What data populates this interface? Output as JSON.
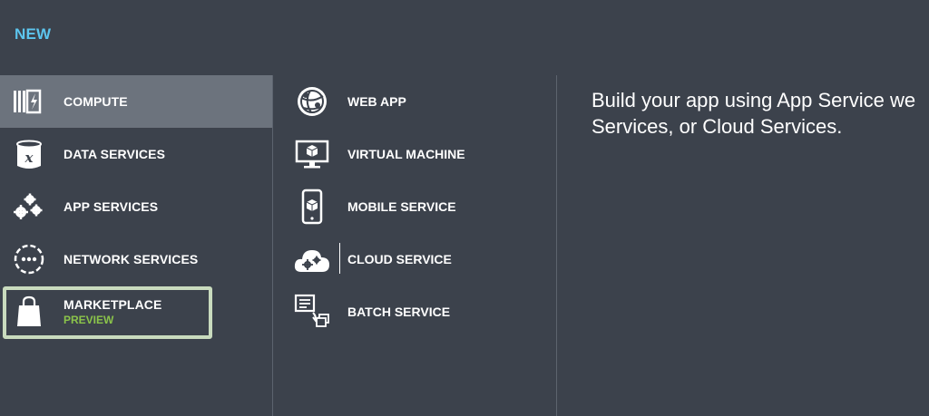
{
  "header": {
    "title": "NEW"
  },
  "categories": [
    {
      "label": "COMPUTE",
      "icon": "compute-icon",
      "selected": true
    },
    {
      "label": "DATA SERVICES",
      "icon": "data-services-icon"
    },
    {
      "label": "APP SERVICES",
      "icon": "app-services-icon"
    },
    {
      "label": "NETWORK SERVICES",
      "icon": "network-services-icon"
    },
    {
      "label": "MARKETPLACE",
      "sublabel": "PREVIEW",
      "icon": "marketplace-bag-icon"
    }
  ],
  "compute_items": [
    {
      "label": "WEB APP",
      "icon": "web-app-icon"
    },
    {
      "label": "VIRTUAL MACHINE",
      "icon": "virtual-machine-icon"
    },
    {
      "label": "MOBILE SERVICE",
      "icon": "mobile-service-icon"
    },
    {
      "label": "CLOUD SERVICE",
      "icon": "cloud-service-icon"
    },
    {
      "label": "BATCH SERVICE",
      "icon": "batch-service-icon"
    }
  ],
  "description": {
    "line1": "Build your app using App Service we",
    "line2": "Services, or Cloud Services."
  },
  "colors": {
    "background": "#3c424c",
    "selected": "#6c737d",
    "title": "#5cc5ee",
    "preview": "#8bc44a",
    "highlight_box": "#d6e8c8"
  }
}
